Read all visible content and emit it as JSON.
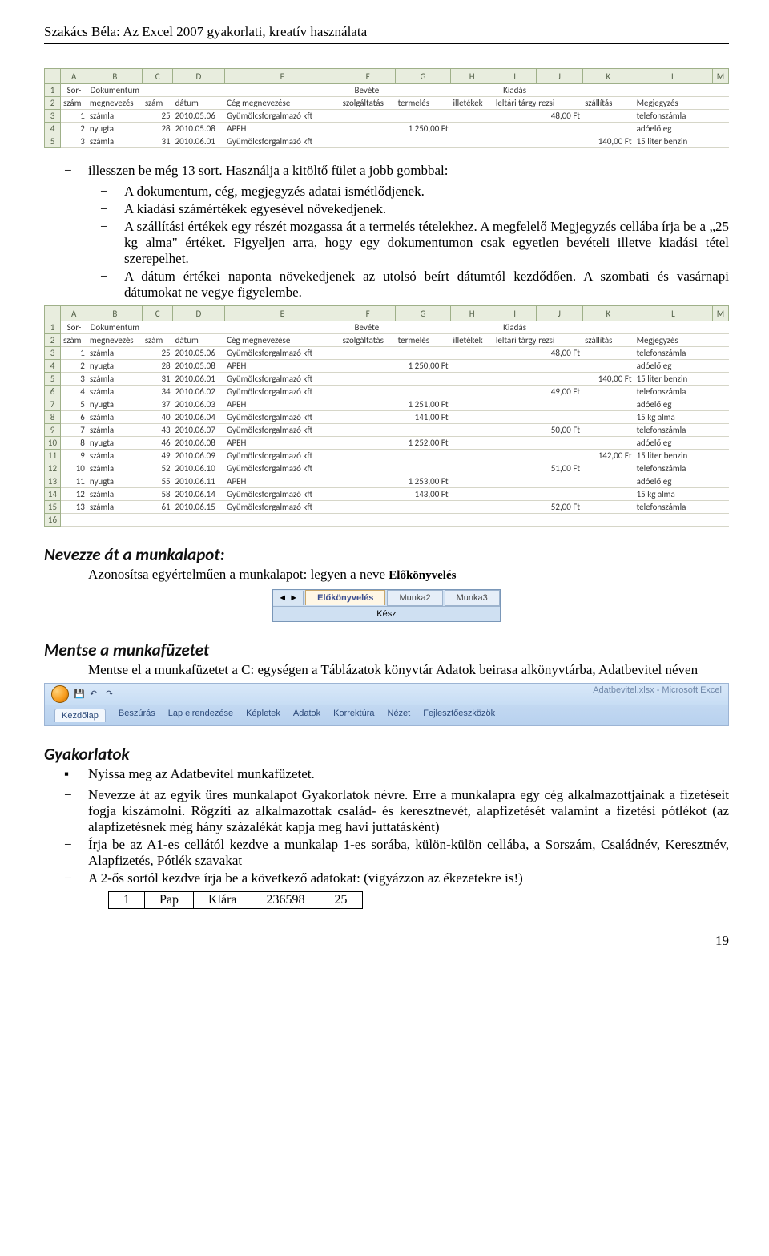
{
  "header": "Szakács Béla: Az Excel 2007 gyakorlati, kreatív használata",
  "ss1": {
    "cols": [
      "",
      "A",
      "B",
      "C",
      "D",
      "E",
      "F",
      "G",
      "H",
      "I",
      "J",
      "K",
      "L",
      "M"
    ],
    "group": [
      "1",
      "Sor-",
      "Dokumentum",
      "",
      "",
      "",
      "Bevétel",
      "",
      "",
      "Kiadás",
      "",
      "",
      "",
      ""
    ],
    "sub": [
      "2",
      "szám",
      "megnevezés",
      "szám",
      "dátum",
      "Cég megnevezése",
      "szolgáltatás",
      "termelés",
      "illetékek",
      "leltári tárgyak",
      "rezsi",
      "szállítás",
      "Megjegyzés",
      ""
    ],
    "rows": [
      [
        "3",
        "1",
        "számla",
        "25",
        "2010.05.06",
        "Gyümölcsforgalmazó kft",
        "",
        "",
        "",
        "",
        "48,00 Ft",
        "",
        "telefonszámla",
        ""
      ],
      [
        "4",
        "2",
        "nyugta",
        "28",
        "2010.05.08",
        "APEH",
        "",
        "1 250,00 Ft",
        "",
        "",
        "",
        "",
        "adóelőleg",
        ""
      ],
      [
        "5",
        "3",
        "számla",
        "31",
        "2010.06.01",
        "Gyümölcsforgalmazó kft",
        "",
        "",
        "",
        "",
        "",
        "140,00 Ft",
        "15 liter benzin",
        ""
      ]
    ]
  },
  "bullets1": {
    "lead": "illesszen be még 13 sort. Használja a kitöltő fület a jobb gombbal:",
    "items": [
      "A dokumentum, cég, megjegyzés adatai ismétlődjenek.",
      "A kiadási számértékek egyesével növekedjenek.",
      "A szállítási értékek egy részét mozgassa át a termelés tételekhez. A megfelelő Megjegyzés cellába írja be a „25 kg alma\" értéket. Figyeljen arra, hogy egy dokumentumon csak egyetlen bevételi illetve kiadási tétel szerepelhet.",
      "A dátum értékei naponta növekedjenek az utolsó beírt dátumtól kezdődően. A szombati és vasárnapi dátumokat ne vegye figyelembe."
    ]
  },
  "ss2": {
    "cols": [
      "",
      "A",
      "B",
      "C",
      "D",
      "E",
      "F",
      "G",
      "H",
      "I",
      "J",
      "K",
      "L",
      "M"
    ],
    "group": [
      "1",
      "Sor-",
      "Dokumentum",
      "",
      "",
      "",
      "Bevétel",
      "",
      "",
      "Kiadás",
      "",
      "",
      "",
      ""
    ],
    "sub": [
      "2",
      "szám",
      "megnevezés",
      "szám",
      "dátum",
      "Cég megnevezése",
      "szolgáltatás",
      "termelés",
      "illetékek",
      "leltári tárgyak",
      "rezsi",
      "szállítás",
      "Megjegyzés",
      ""
    ],
    "rows": [
      [
        "3",
        "1",
        "számla",
        "25",
        "2010.05.06",
        "Gyümölcsforgalmazó kft",
        "",
        "",
        "",
        "",
        "48,00 Ft",
        "",
        "telefonszámla",
        ""
      ],
      [
        "4",
        "2",
        "nyugta",
        "28",
        "2010.05.08",
        "APEH",
        "",
        "1 250,00 Ft",
        "",
        "",
        "",
        "",
        "adóelőleg",
        ""
      ],
      [
        "5",
        "3",
        "számla",
        "31",
        "2010.06.01",
        "Gyümölcsforgalmazó kft",
        "",
        "",
        "",
        "",
        "",
        "140,00 Ft",
        "15 liter benzin",
        ""
      ],
      [
        "6",
        "4",
        "számla",
        "34",
        "2010.06.02",
        "Gyümölcsforgalmazó kft",
        "",
        "",
        "",
        "",
        "49,00 Ft",
        "",
        "telefonszámla",
        ""
      ],
      [
        "7",
        "5",
        "nyugta",
        "37",
        "2010.06.03",
        "APEH",
        "",
        "1 251,00 Ft",
        "",
        "",
        "",
        "",
        "adóelőleg",
        ""
      ],
      [
        "8",
        "6",
        "számla",
        "40",
        "2010.06.04",
        "Gyümölcsforgalmazó kft",
        "",
        "141,00 Ft",
        "",
        "",
        "",
        "",
        "15 kg alma",
        ""
      ],
      [
        "9",
        "7",
        "számla",
        "43",
        "2010.06.07",
        "Gyümölcsforgalmazó kft",
        "",
        "",
        "",
        "",
        "50,00 Ft",
        "",
        "telefonszámla",
        ""
      ],
      [
        "10",
        "8",
        "nyugta",
        "46",
        "2010.06.08",
        "APEH",
        "",
        "1 252,00 Ft",
        "",
        "",
        "",
        "",
        "adóelőleg",
        ""
      ],
      [
        "11",
        "9",
        "számla",
        "49",
        "2010.06.09",
        "Gyümölcsforgalmazó kft",
        "",
        "",
        "",
        "",
        "",
        "142,00 Ft",
        "15 liter benzin",
        ""
      ],
      [
        "12",
        "10",
        "számla",
        "52",
        "2010.06.10",
        "Gyümölcsforgalmazó kft",
        "",
        "",
        "",
        "",
        "51,00 Ft",
        "",
        "telefonszámla",
        ""
      ],
      [
        "13",
        "11",
        "nyugta",
        "55",
        "2010.06.11",
        "APEH",
        "",
        "1 253,00 Ft",
        "",
        "",
        "",
        "",
        "adóelőleg",
        ""
      ],
      [
        "14",
        "12",
        "számla",
        "58",
        "2010.06.14",
        "Gyümölcsforgalmazó kft",
        "",
        "143,00 Ft",
        "",
        "",
        "",
        "",
        "15 kg alma",
        ""
      ],
      [
        "15",
        "13",
        "számla",
        "61",
        "2010.06.15",
        "Gyümölcsforgalmazó kft",
        "",
        "",
        "",
        "",
        "52,00 Ft",
        "",
        "telefonszámla",
        ""
      ],
      [
        "16",
        "",
        "",
        "",
        "",
        "",
        "",
        "",
        "",
        "",
        "",
        "",
        "",
        ""
      ]
    ]
  },
  "sec_rename": {
    "title": "Nevezze át a munkalapot:",
    "text_pre": "Azonosítsa egyértelműen a munkalapot: legyen a neve ",
    "text_bold": "Előkönyvelés"
  },
  "tabs": {
    "nav": "◄ ►",
    "t1": "Előkönyvelés",
    "t2": "Munka2",
    "t3": "Munka3",
    "status": "Kész"
  },
  "sec_save": {
    "title": "Mentse a munkafüzetet",
    "text": "Mentse el a munkafüzetet a C: egységen a Táblázatok könyvtár Adatok beirasa alkönyvtárba, Adatbevitel néven"
  },
  "ribbon": {
    "title": "Adatbevitel.xlsx - Microsoft Excel",
    "tabs": [
      "Kezdőlap",
      "Beszúrás",
      "Lap elrendezése",
      "Képletek",
      "Adatok",
      "Korrektúra",
      "Nézet",
      "Fejlesztőeszközök"
    ]
  },
  "sec_gyak": {
    "title": "Gyakorlatok",
    "sq": "Nyissa meg az Adatbevitel munkafüzetet.",
    "d1": "Nevezze át az egyik üres munkalapot Gyakorlatok névre. Erre a munkalapra egy cég alkalmazottjainak a fizetéseit fogja kiszámolni. Rögzíti az alkalmazottak család- és keresztnevét, alapfizetését valamint a fizetési pótlékot (az alapfizetésnek még hány százalékát kapja meg havi juttatásként)",
    "d2": "Írja be az A1-es cellától kezdve a munkalap 1-es sorába, külön-külön cellába, a Sorszám, Családnév, Keresztnév, Alapfizetés, Pótlék szavakat",
    "d3": "A 2-ős sortól kezdve írja be a következő adatokat: (vigyázzon az ékezetekre is!)"
  },
  "inline_table": [
    "1",
    "Pap",
    "Klára",
    "236598",
    "25"
  ],
  "page_num": "19"
}
